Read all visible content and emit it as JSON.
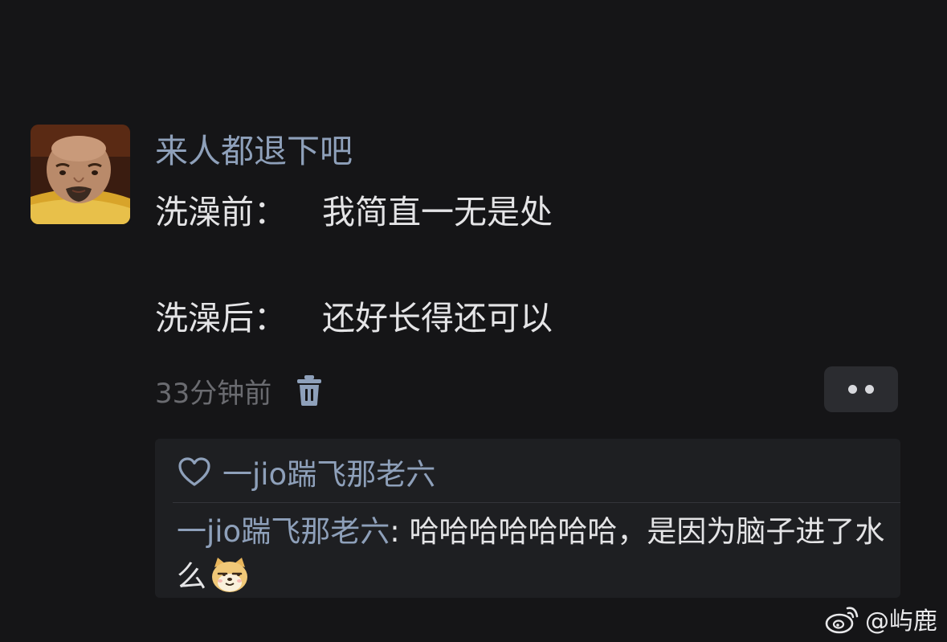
{
  "comment": {
    "author": "来人都退下吧",
    "line1_label": "洗澡前：",
    "line1_text": "我简直一无是处",
    "line2_label": "洗澡后：",
    "line2_text": "还好长得还可以",
    "timestamp": "33分钟前",
    "icons": {
      "avatar": "avatar-photo",
      "delete": "trash-icon",
      "more": "more-dots-icon"
    }
  },
  "reply_section": {
    "liked_by": "一jio踹飞那老六",
    "reply_author": "一jio踹飞那老六",
    "reply_separator": ": ",
    "reply_text": "哈哈哈哈哈哈哈，是因为脑子进了水么",
    "icons": {
      "like": "heart-icon",
      "emoji": "doge-emoji"
    }
  },
  "watermark": {
    "text": "@屿鹿",
    "icon": "weibo-icon"
  },
  "colors": {
    "background": "#151517",
    "name_blue": "#8ea0ba",
    "text": "#e4e4e6",
    "muted": "#6a6b70",
    "reply_bg": "#1e1f22"
  }
}
